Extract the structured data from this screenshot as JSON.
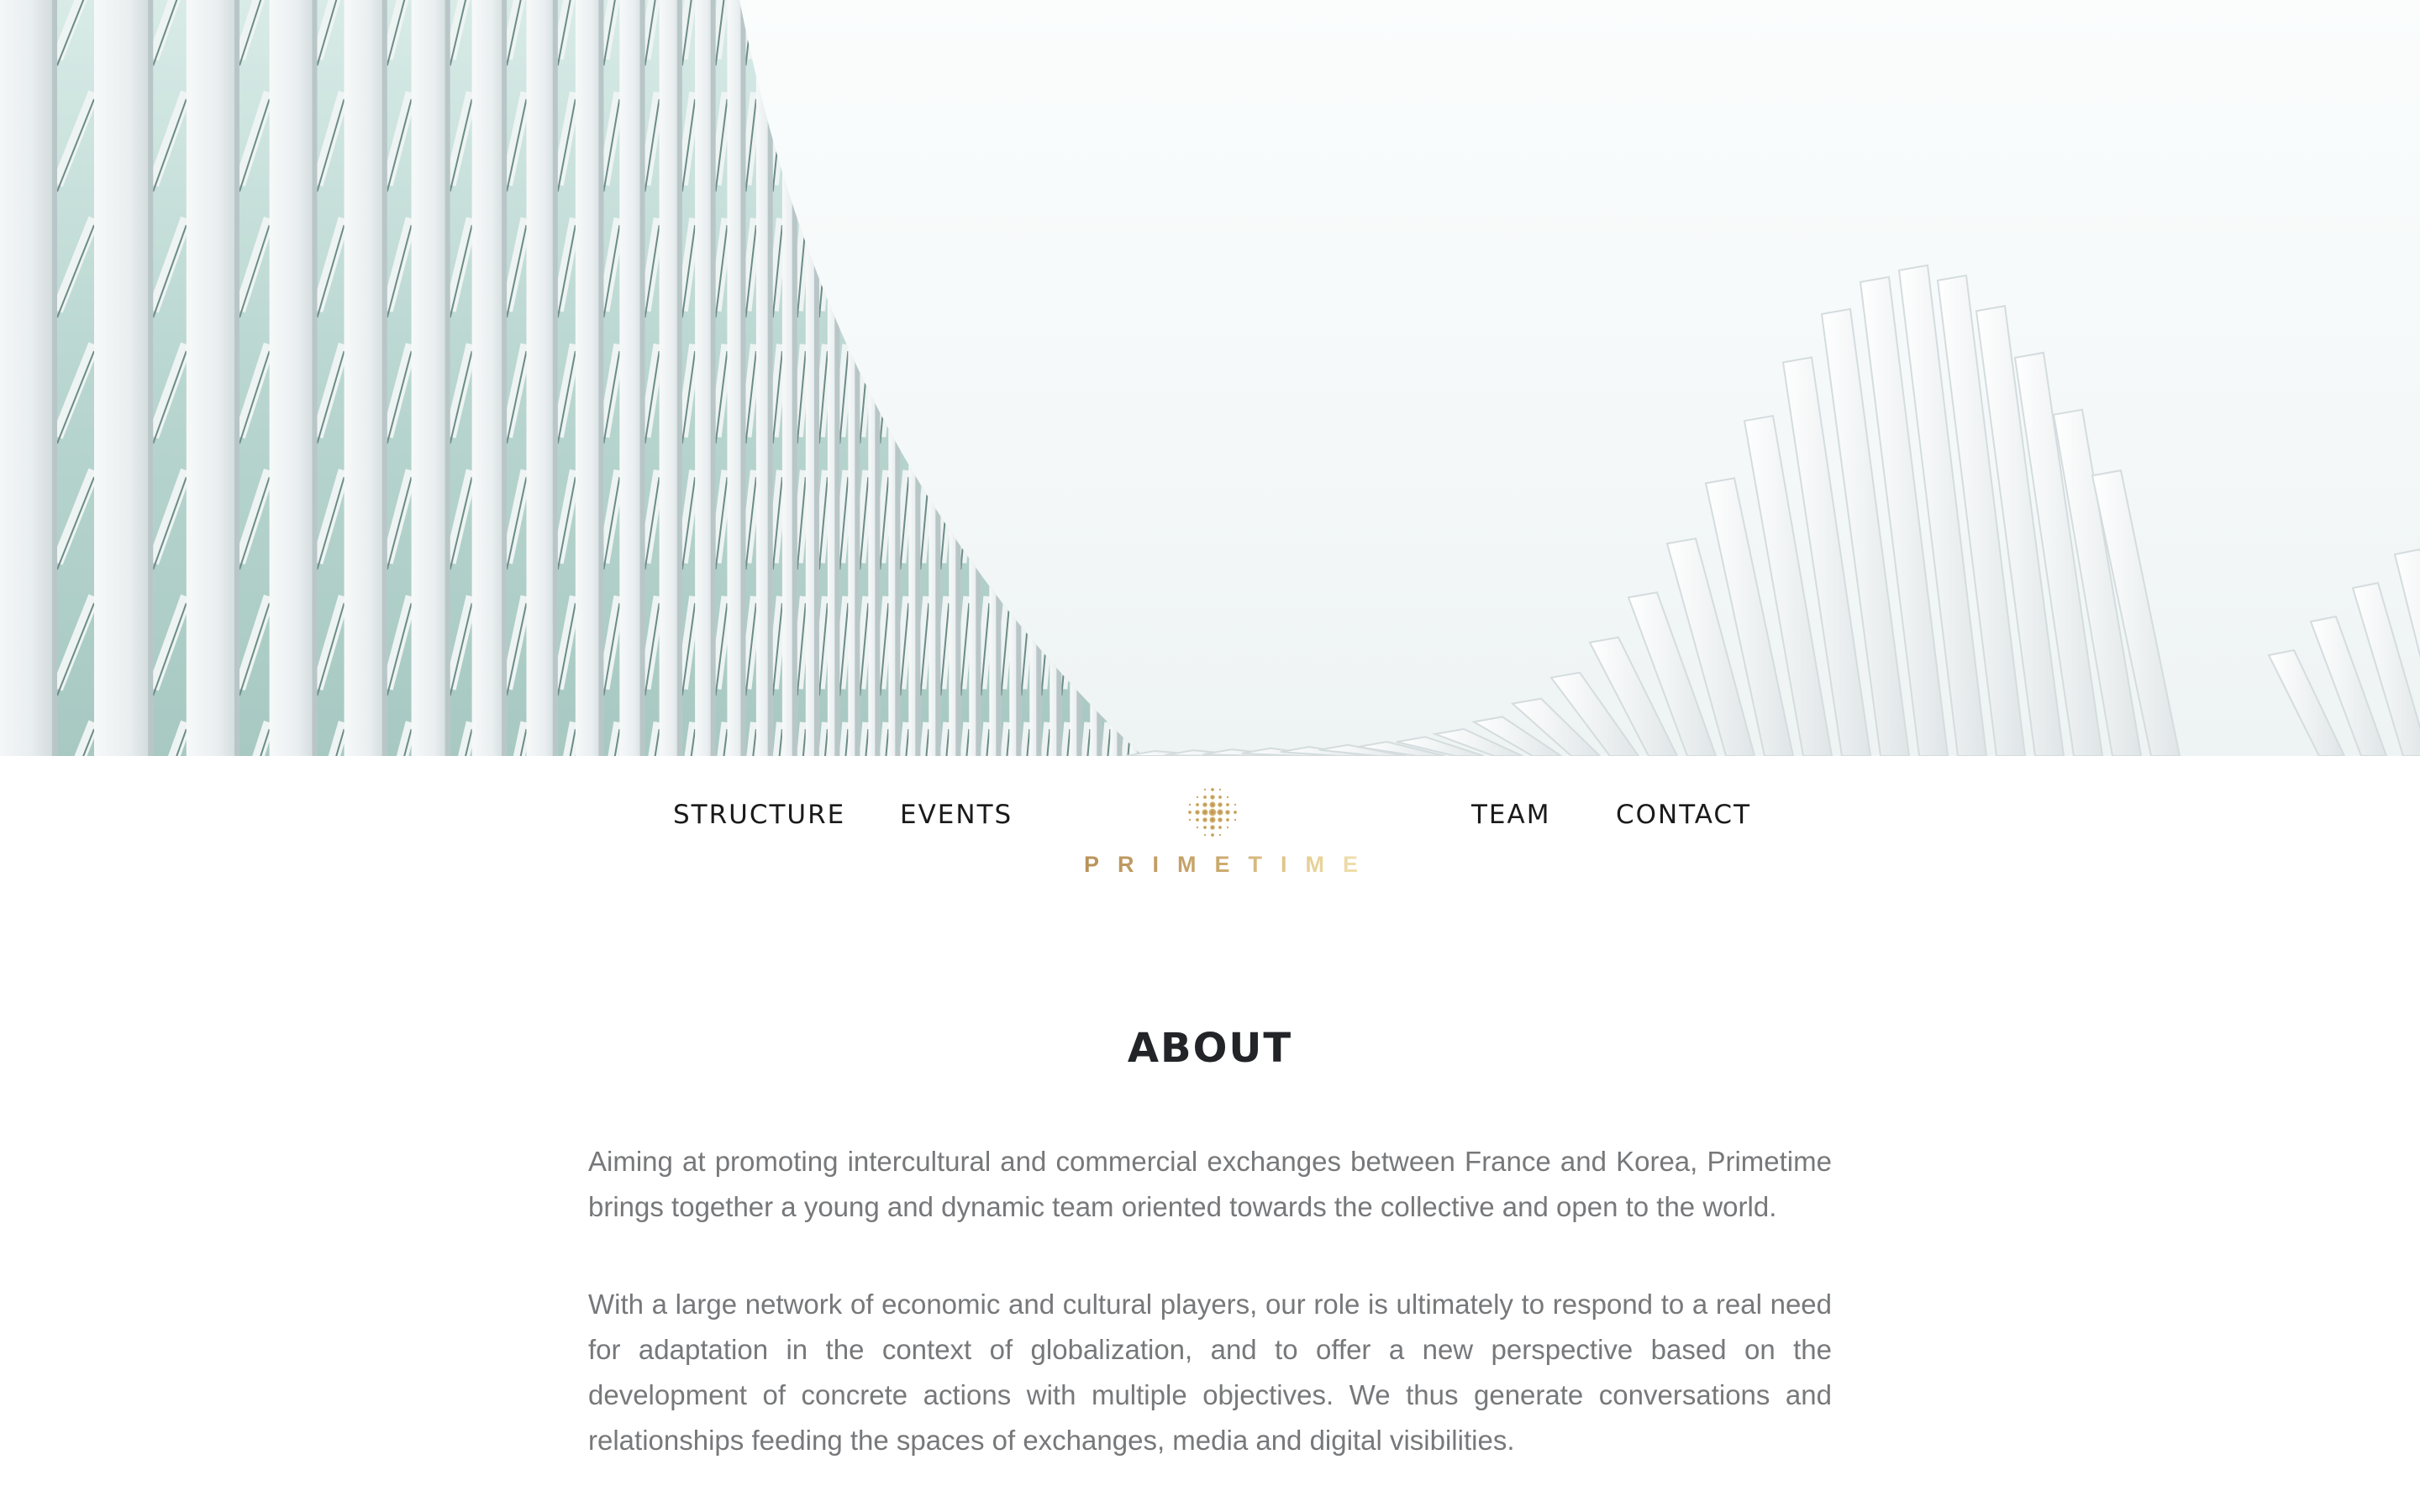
{
  "hero": {
    "image": "architecture-white-fins-image"
  },
  "nav": {
    "links": [
      {
        "label": "STRUCTURE"
      },
      {
        "label": "EVENTS"
      },
      {
        "label": "TEAM"
      },
      {
        "label": "CONTACT"
      }
    ],
    "logo": {
      "wordmark": "PRIMETIME",
      "icon": "dot-grid-logo-icon",
      "colors": [
        "#b8925a",
        "#c9a66c",
        "#e3cc8f",
        "#f1e3b5"
      ]
    }
  },
  "about": {
    "title": "ABOUT",
    "paragraphs": [
      "Aiming at promoting intercultural and commercial exchanges between France and Korea, Primetime brings together a young and dynamic team oriented towards the collective and open to the world.",
      "With a large network of economic and cultural players, our role is ultimately to respond to a real need for adaptation in the context of globalization, and to offer a new perspective based on the development of concrete actions with multiple objectives. We thus generate conversations and relationships feeding the spaces of exchanges, media and digital visibilities."
    ]
  },
  "colors": {
    "text_dark": "#1a1a1a",
    "heading": "#222428",
    "body_text": "#77787a",
    "logo_gold": "#c4a067"
  }
}
